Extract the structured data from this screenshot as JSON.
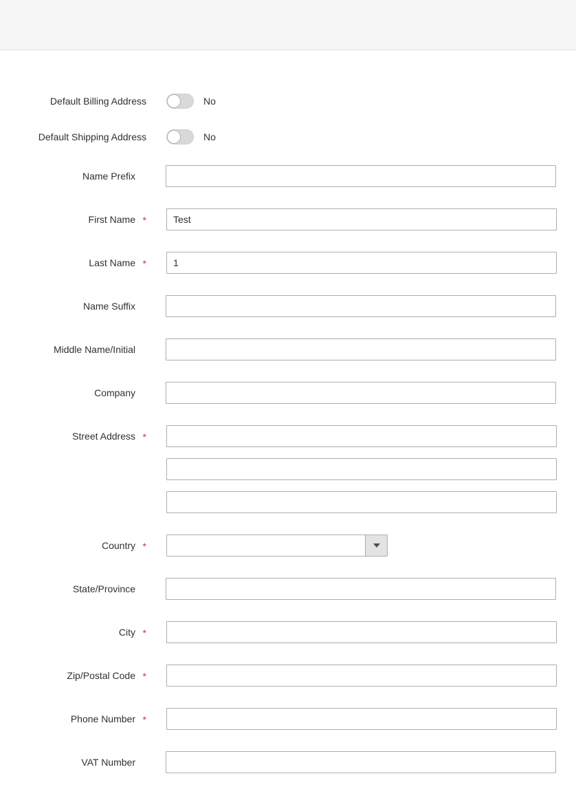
{
  "header": {
    "title": ""
  },
  "form": {
    "toggles": [
      {
        "label": "Default Billing Address",
        "value": "No",
        "state": "off",
        "name": "default-billing-address"
      },
      {
        "label": "Default Shipping Address",
        "value": "No",
        "state": "off",
        "name": "default-shipping-address"
      }
    ],
    "fields": [
      {
        "label": "Name Prefix",
        "required": false,
        "value": "",
        "placeholder": "",
        "name": "name-prefix"
      },
      {
        "label": "First Name",
        "required": true,
        "value": "Test",
        "placeholder": "",
        "name": "first-name"
      },
      {
        "label": "Last Name",
        "required": true,
        "value": "1",
        "placeholder": "",
        "name": "last-name"
      },
      {
        "label": "Name Suffix",
        "required": false,
        "value": "",
        "placeholder": "",
        "name": "name-suffix"
      },
      {
        "label": "Middle Name/Initial",
        "required": false,
        "value": "",
        "placeholder": "",
        "name": "middle-name-initial"
      },
      {
        "label": "Company",
        "required": false,
        "value": "",
        "placeholder": "",
        "name": "company"
      }
    ],
    "street": {
      "label": "Street Address",
      "required": true,
      "lines": [
        {
          "value": "",
          "placeholder": "",
          "name": "street-address-line-1"
        },
        {
          "value": "",
          "placeholder": "",
          "name": "street-address-line-2"
        },
        {
          "value": "",
          "placeholder": "",
          "name": "street-address-line-3"
        }
      ]
    },
    "country": {
      "label": "Country",
      "required": true,
      "selected": "",
      "name": "country",
      "arrow_icon": "chevron-down-icon"
    },
    "fields_after": [
      {
        "label": "State/Province",
        "required": false,
        "value": "",
        "placeholder": "",
        "name": "state-province"
      },
      {
        "label": "City",
        "required": true,
        "value": "",
        "placeholder": "",
        "name": "city"
      },
      {
        "label": "Zip/Postal Code",
        "required": true,
        "value": "",
        "placeholder": "",
        "name": "zip-postal-code"
      },
      {
        "label": "Phone Number",
        "required": true,
        "value": "",
        "placeholder": "",
        "name": "phone-number"
      },
      {
        "label": "VAT Number",
        "required": false,
        "value": "",
        "placeholder": "",
        "name": "vat-number"
      }
    ]
  },
  "colors": {
    "required_star": "#e02b27",
    "label_text": "#303030",
    "input_border": "#adadad",
    "header_bg": "#f7f7f7",
    "toggle_track": "#d9d9d9"
  }
}
